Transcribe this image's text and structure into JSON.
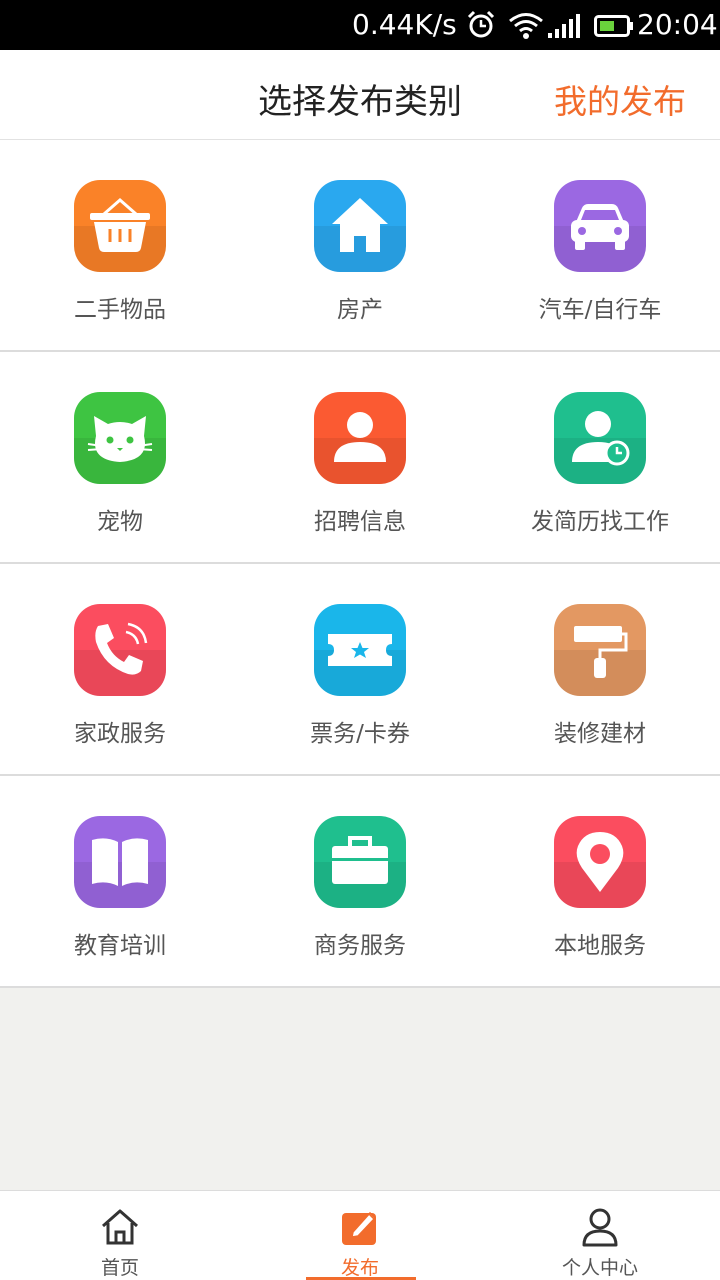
{
  "status_bar": {
    "net_speed": "0.44K/s",
    "time": "20:04"
  },
  "header": {
    "title": "选择发布类别",
    "my_publish": "我的发布"
  },
  "categories": [
    {
      "label": "二手物品",
      "icon": "basket-icon",
      "color": "#fa8228"
    },
    {
      "label": "房产",
      "icon": "house-icon",
      "color": "#2aa8ef"
    },
    {
      "label": "汽车/自行车",
      "icon": "car-icon",
      "color": "#9b68e2"
    },
    {
      "label": "宠物",
      "icon": "cat-icon",
      "color": "#3ec442"
    },
    {
      "label": "招聘信息",
      "icon": "person-icon",
      "color": "#fb5a32"
    },
    {
      "label": "发简历找工作",
      "icon": "person-clock-icon",
      "color": "#1fbf8e"
    },
    {
      "label": "家政服务",
      "icon": "phone-icon",
      "color": "#fb4d5f"
    },
    {
      "label": "票务/卡券",
      "icon": "ticket-icon",
      "color": "#1ab6ea"
    },
    {
      "label": "装修建材",
      "icon": "paint-roller-icon",
      "color": "#e39862"
    },
    {
      "label": "教育培训",
      "icon": "book-icon",
      "color": "#9b68e2"
    },
    {
      "label": "商务服务",
      "icon": "briefcase-icon",
      "color": "#1fbf8e"
    },
    {
      "label": "本地服务",
      "icon": "location-pin-icon",
      "color": "#fb4d5f"
    }
  ],
  "tabs": [
    {
      "label": "首页",
      "icon": "home-icon"
    },
    {
      "label": "发布",
      "icon": "publish-icon",
      "active": true
    },
    {
      "label": "个人中心",
      "icon": "profile-icon"
    }
  ],
  "accent_color": "#f26c2c"
}
